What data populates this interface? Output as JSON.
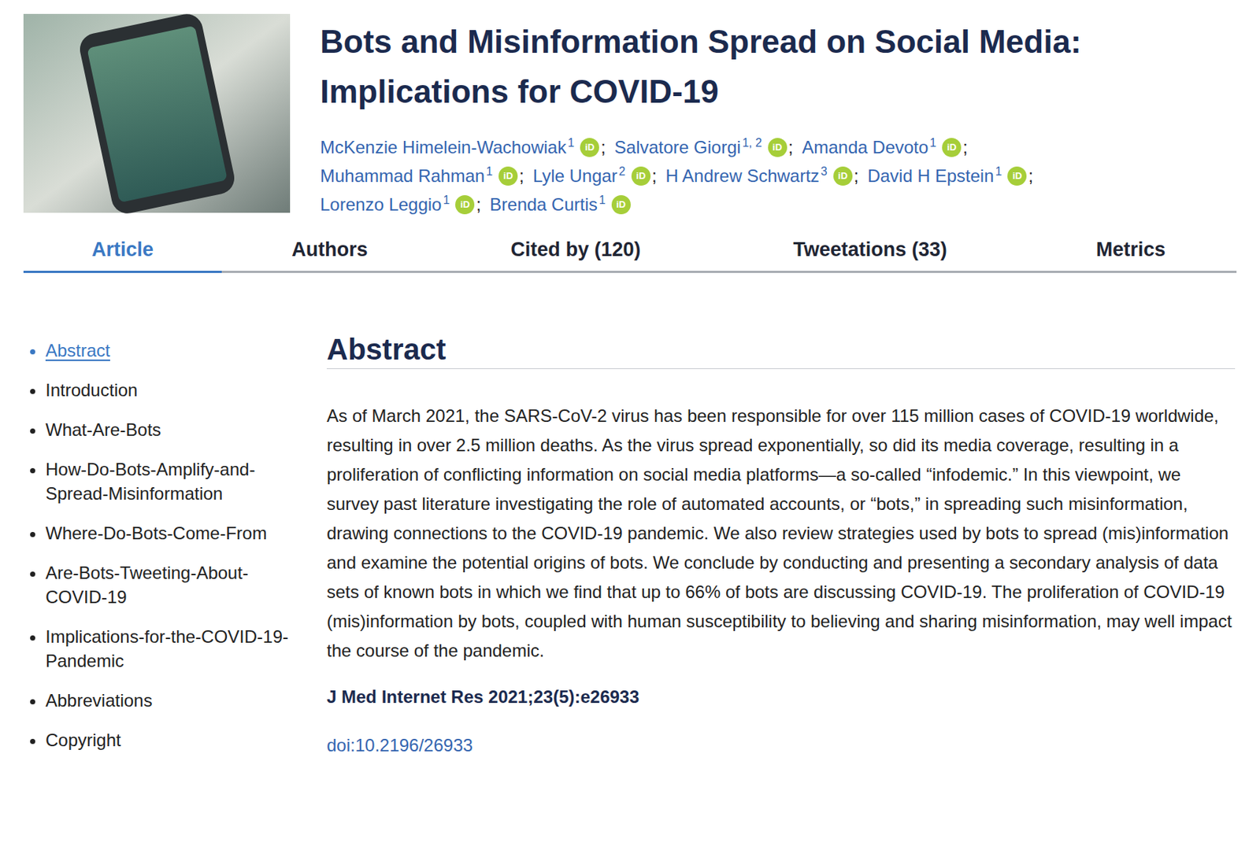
{
  "article": {
    "title": "Bots and Misinformation Spread on Social Media: Implications for COVID-19",
    "orcid_badge": "iD",
    "author_separator": ";",
    "author_rows": [
      [
        {
          "name": "McKenzie Himelein-Wachowiak",
          "affiliation": "1"
        },
        {
          "name": "Salvatore Giorgi",
          "affiliation": "1, 2"
        },
        {
          "name": "Amanda Devoto",
          "affiliation": "1"
        }
      ],
      [
        {
          "name": "Muhammad Rahman",
          "affiliation": "1"
        },
        {
          "name": "Lyle Ungar",
          "affiliation": "2"
        },
        {
          "name": "H Andrew Schwartz",
          "affiliation": "3"
        },
        {
          "name": "David H Epstein",
          "affiliation": "1"
        }
      ],
      [
        {
          "name": "Lorenzo Leggio",
          "affiliation": "1"
        },
        {
          "name": "Brenda Curtis",
          "affiliation": "1"
        }
      ]
    ]
  },
  "tabs": [
    {
      "label": "Article",
      "selected": true
    },
    {
      "label": "Authors",
      "selected": false
    },
    {
      "label": "Cited by (120)",
      "selected": false
    },
    {
      "label": "Tweetations (33)",
      "selected": false
    },
    {
      "label": "Metrics",
      "selected": false
    }
  ],
  "sidebar": {
    "items": [
      {
        "label": "Abstract",
        "selected": true
      },
      {
        "label": "Introduction",
        "selected": false
      },
      {
        "label": "What-Are-Bots",
        "selected": false
      },
      {
        "label": "How-Do-Bots-Amplify-and-Spread-Misinformation",
        "selected": false
      },
      {
        "label": "Where-Do-Bots-Come-From",
        "selected": false
      },
      {
        "label": "Are-Bots-Tweeting-About-COVID-19",
        "selected": false
      },
      {
        "label": "Implications-for-the-COVID-19-Pandemic",
        "selected": false
      },
      {
        "label": "Abbreviations",
        "selected": false
      },
      {
        "label": "Copyright",
        "selected": false
      }
    ]
  },
  "abstract": {
    "heading": "Abstract",
    "text": "As of March 2021, the SARS-CoV-2 virus has been responsible for over 115 million cases of COVID-19 worldwide, resulting in over 2.5 million deaths. As the virus spread exponentially, so did its media coverage, resulting in a proliferation of conflicting information on social media platforms—a so-called “infodemic.” In this viewpoint, we survey past literature investigating the role of automated accounts, or “bots,” in spreading such misinformation, drawing connections to the COVID-19 pandemic. We also review strategies used by bots to spread (mis)information and examine the potential origins of bots. We conclude by conducting and presenting a secondary analysis of data sets of known bots in which we find that up to 66% of bots are discussing COVID-19. The proliferation of COVID-19 (mis)information by bots, coupled with human susceptibility to believing and sharing misinformation, may well impact the course of the pandemic.",
    "citation": "J Med Internet Res 2021;23(5):e26933",
    "doi": "doi:10.2196/26933"
  }
}
